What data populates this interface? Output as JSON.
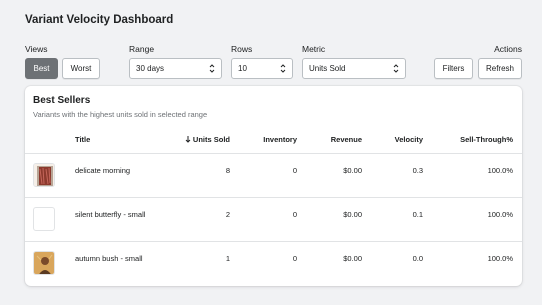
{
  "header": {
    "title": "Variant Velocity Dashboard"
  },
  "controls": {
    "views_label": "Views",
    "view_best": "Best",
    "view_worst": "Worst",
    "range_label": "Range",
    "range_value": "30 days",
    "rows_label": "Rows",
    "rows_value": "10",
    "metric_label": "Metric",
    "metric_value": "Units Sold",
    "actions_label": "Actions",
    "filters_button": "Filters",
    "refresh_button": "Refresh"
  },
  "card": {
    "title": "Best Sellers",
    "subtitle": "Variants with the highest units sold in selected range"
  },
  "table": {
    "columns": [
      "Title",
      "Units Sold",
      "Inventory",
      "Revenue",
      "Velocity",
      "Sell-Through%"
    ],
    "sort_column": "Units Sold",
    "rows": [
      {
        "title": "delicate morning",
        "units_sold": "8",
        "inventory": "0",
        "revenue": "$0.00",
        "velocity": "0.3",
        "sell_through": "100.0%",
        "thumb": "painting-thumbnail"
      },
      {
        "title": "silent butterfly - small",
        "units_sold": "2",
        "inventory": "0",
        "revenue": "$0.00",
        "velocity": "0.1",
        "sell_through": "100.0%",
        "thumb": "blank-thumbnail"
      },
      {
        "title": "autumn bush - small",
        "units_sold": "1",
        "inventory": "0",
        "revenue": "$0.00",
        "velocity": "0.0",
        "sell_through": "100.0%",
        "thumb": "portrait-thumbnail"
      }
    ]
  },
  "colors": {
    "background": "#f1f2f4",
    "active_button": "#6d7175",
    "border": "#babfc3",
    "divider": "#e1e3e5",
    "muted_text": "#6d7175"
  }
}
